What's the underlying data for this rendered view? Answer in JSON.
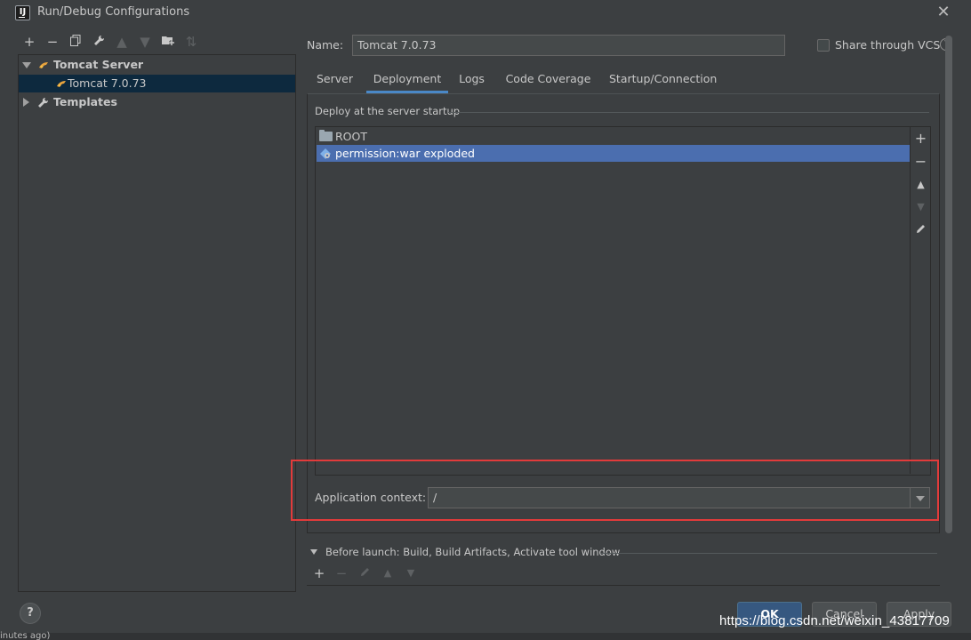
{
  "window": {
    "title": "Run/Debug Configurations",
    "app_icon": "IJ"
  },
  "left_toolbar": {
    "icons": [
      "add-icon",
      "remove-icon",
      "copy-icon",
      "wrench-icon",
      "move-up-icon",
      "move-down-icon",
      "new-folder-icon",
      "sort-icon"
    ]
  },
  "tree": {
    "group": {
      "label": "Tomcat Server",
      "expanded": true
    },
    "child": {
      "label": "Tomcat 7.0.73",
      "selected": true
    },
    "templates": {
      "label": "Templates",
      "expanded": false
    }
  },
  "name_field": {
    "label": "Name:",
    "value": "Tomcat 7.0.73"
  },
  "share": {
    "label": "Share through VCS",
    "checked": false
  },
  "tabs": [
    {
      "label": "Server",
      "active": false
    },
    {
      "label": "Deployment",
      "active": true
    },
    {
      "label": "Logs",
      "active": false
    },
    {
      "label": "Code Coverage",
      "active": false
    },
    {
      "label": "Startup/Connection",
      "active": false
    }
  ],
  "deployment": {
    "caption": "Deploy at the server startup",
    "items": [
      {
        "label": "ROOT",
        "icon": "folder-icon",
        "selected": false
      },
      {
        "label": "permission:war exploded",
        "icon": "artifact-icon",
        "selected": true
      }
    ],
    "toolbar_icons": [
      "add-icon",
      "remove-icon",
      "move-up-icon",
      "move-down-icon",
      "edit-icon"
    ]
  },
  "app_context": {
    "label": "Application context:",
    "value": "/"
  },
  "before_launch": {
    "label": "Before launch: Build, Build Artifacts, Activate tool window",
    "toolbar_icons": [
      "add-icon",
      "remove-icon",
      "edit-icon",
      "move-up-icon",
      "move-down-icon"
    ]
  },
  "buttons": {
    "ok": "OK",
    "cancel": "Cancel",
    "apply": "Apply",
    "help": "?"
  },
  "watermark": "https://blog.csdn.net/weixin_43817709",
  "bottom_status": "inutes ago)",
  "colors": {
    "background": "#3c3f41",
    "selection": "#4b6eaf",
    "tree_selection": "#0d293e",
    "tab_underline": "#4a88c7",
    "highlight_box": "#e23b3b",
    "ok_button": "#365880"
  }
}
